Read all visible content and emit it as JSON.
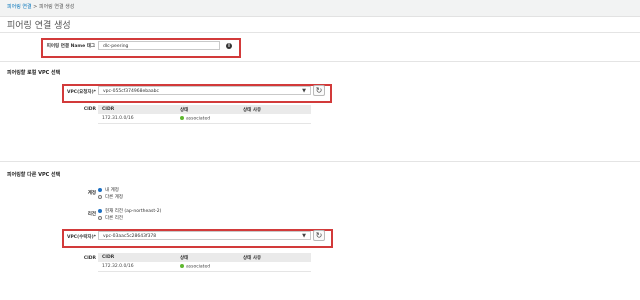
{
  "breadcrumb": {
    "parent": "피어링 연결",
    "separator": " > ",
    "current": "피어링 연결 생성"
  },
  "page_title": "피어링 연결 생성",
  "name_tag": {
    "label": "피어링 연결 Name 태그",
    "value": "dlc-peering"
  },
  "local": {
    "section_title": "피어링할 로컬 VPC 선택",
    "vpc_label": "VPC(요청자)*",
    "vpc_value": "vpc-055cf374968ebaabc",
    "cidr_label": "CIDR",
    "table": {
      "headers": [
        "CIDR",
        "상태",
        "상태 사유"
      ],
      "rows": [
        {
          "cidr": "172.31.0.0/16",
          "status": "associated",
          "reason": ""
        }
      ]
    }
  },
  "other": {
    "section_title": "피어링할 다른 VPC 선택",
    "account_label": "계정",
    "account_options": [
      "내 계정",
      "다른 계정"
    ],
    "account_selected": 0,
    "region_label": "리전",
    "region_options": [
      "현재 리전 (ap-northeast-2)",
      "다른 리전"
    ],
    "region_selected": 0,
    "vpc_label": "VPC(수락자)*",
    "vpc_value": "vpc-03aac5c28643f378",
    "cidr_label": "CIDR",
    "table": {
      "headers": [
        "CIDR",
        "상태",
        "상태 사유"
      ],
      "rows": [
        {
          "cidr": "172.32.0.0/16",
          "status": "associated",
          "reason": ""
        }
      ]
    }
  },
  "colors": {
    "highlight_border": "#d23a3a",
    "link": "#0073bb",
    "status_ok": "#5fb830",
    "table_header": "#eaeaea"
  }
}
